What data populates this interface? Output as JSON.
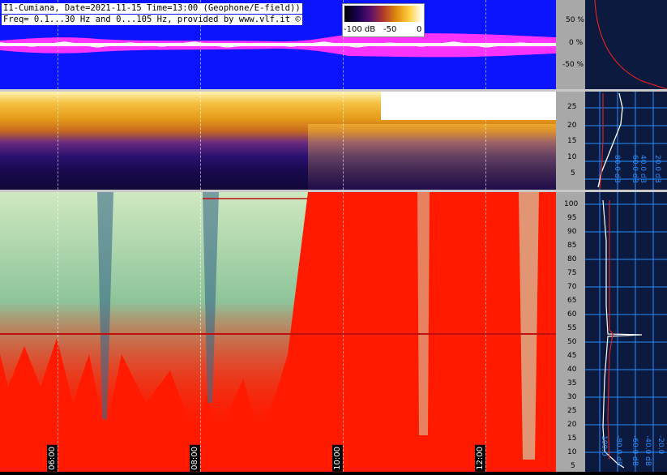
{
  "header": {
    "line1": "I1-Cumiana, Date=2021-11-15 Time=13:00 (Geophone/E-field))",
    "line2": "Freq= 0.1...30 Hz and 0...105 Hz, provided by www.vlf.it ©"
  },
  "colorbar": {
    "label_left": "-100 dB",
    "label_mid": "-50",
    "label_right": "0"
  },
  "wave_axis": {
    "ticks": [
      "50 %",
      "0 %",
      "-50 %"
    ]
  },
  "low_axis": {
    "ticks": [
      "25",
      "20",
      "15",
      "10",
      "5"
    ]
  },
  "high_axis": {
    "ticks": [
      "100",
      "95",
      "90",
      "85",
      "80",
      "75",
      "70",
      "65",
      "60",
      "55",
      "50",
      "45",
      "40",
      "35",
      "30",
      "25",
      "20",
      "15",
      "10",
      "5"
    ]
  },
  "time_axis": {
    "labels": [
      "06:00",
      "08:00",
      "10:00",
      "12:00"
    ]
  },
  "profile_mid": {
    "labels": [
      "80.0 dB",
      "60.0 dB",
      "40.0 dB",
      "20.0 dB"
    ]
  },
  "profile_bot": {
    "labels": [
      "100.0",
      "-80.0 dB",
      "-60.0 dB",
      "-40.0 dB",
      "-20.0"
    ]
  },
  "colors": {
    "wave_bg": "#0a14ff",
    "wave_env": "#ff33ff",
    "spec_high_bg": "#ff1a00",
    "profile_bg": "#0b1a3e",
    "grid_blue": "#2a8cff"
  }
}
